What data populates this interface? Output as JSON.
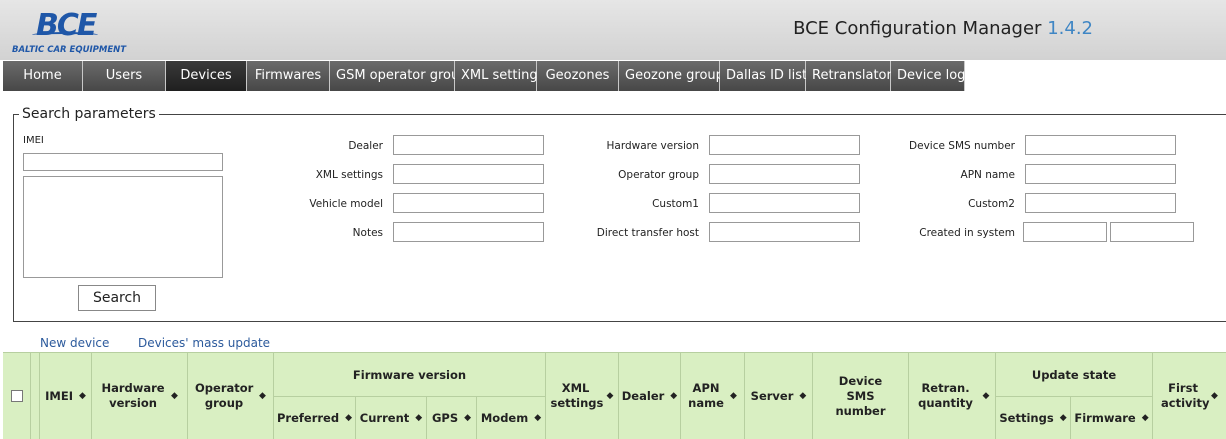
{
  "header": {
    "logo_text": "BCE",
    "logo_subtitle": "BALTIC CAR EQUIPMENT",
    "title": "BCE Configuration Manager",
    "version": "1.4.2"
  },
  "nav": {
    "items": [
      {
        "label": "Home"
      },
      {
        "label": "Users"
      },
      {
        "label": "Devices"
      },
      {
        "label": "Firmwares"
      },
      {
        "label": "GSM operator groups"
      },
      {
        "label": "XML settings"
      },
      {
        "label": "Geozones"
      },
      {
        "label": "Geozone groups"
      },
      {
        "label": "Dallas ID lists"
      },
      {
        "label": "Retranslators"
      },
      {
        "label": "Device logs"
      }
    ],
    "active": "Devices"
  },
  "search": {
    "legend": "Search parameters",
    "imei_label": "IMEI",
    "button_label": "Search",
    "fields": {
      "dealer": "Dealer",
      "xml_settings": "XML settings",
      "vehicle_model": "Vehicle model",
      "notes": "Notes",
      "hardware_version": "Hardware version",
      "operator_group": "Operator group",
      "custom1": "Custom1",
      "direct_transfer_host": "Direct transfer host",
      "device_sms_number": "Device SMS number",
      "apn_name": "APN name",
      "custom2": "Custom2",
      "created_in_system": "Created in system"
    }
  },
  "links": {
    "new_device": "New device",
    "mass_update": "Devices' mass update"
  },
  "table": {
    "sort_glyph": "◆",
    "columns": {
      "imei": "IMEI",
      "hardware_version": "Hardware version",
      "operator_group": "Operator group",
      "firmware_version": "Firmware version",
      "preferred": "Preferred",
      "current": "Current",
      "gps": "GPS",
      "modem": "Modem",
      "xml_settings": "XML settings",
      "dealer": "Dealer",
      "apn_name": "APN name",
      "server": "Server",
      "device_sms_number": "Device SMS number",
      "retran_quantity": "Retran. quantity",
      "update_state": "Update state",
      "settings": "Settings",
      "firmware": "Firmware",
      "first_activity": "First activity"
    }
  }
}
